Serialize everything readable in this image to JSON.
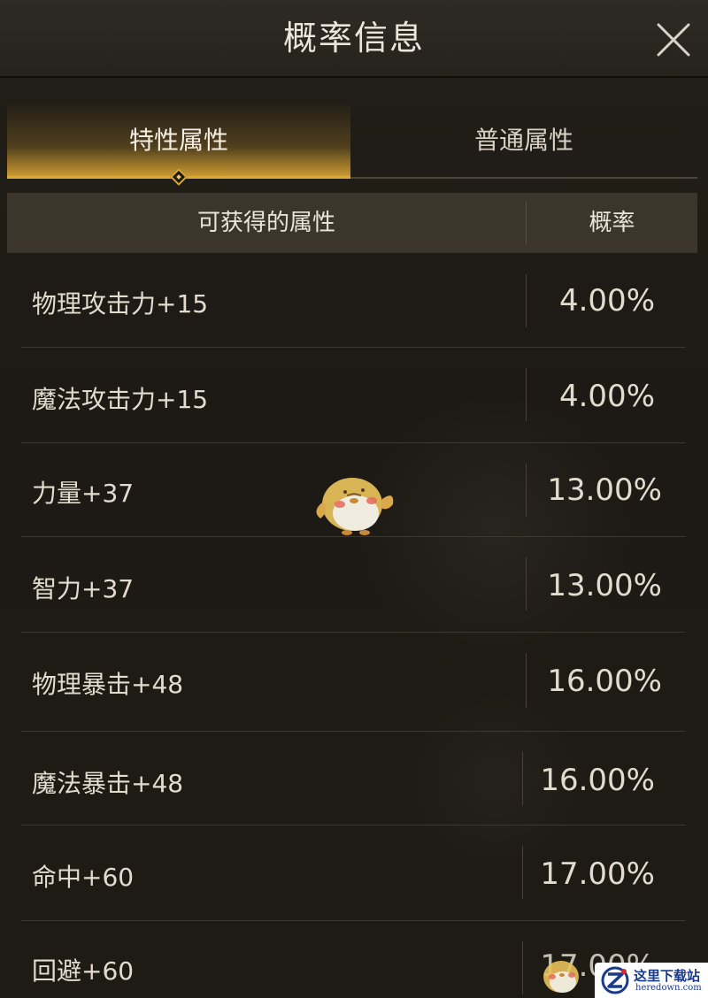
{
  "dialog": {
    "title": "概率信息"
  },
  "tabs": [
    {
      "label": "特性属性",
      "active": true
    },
    {
      "label": "普通属性",
      "active": false
    }
  ],
  "table": {
    "headers": {
      "attribute": "可获得的属性",
      "probability": "概率"
    },
    "rows": [
      {
        "attribute": "物理攻击力+15",
        "probability": "4.00%"
      },
      {
        "attribute": "魔法攻击力+15",
        "probability": "4.00%"
      },
      {
        "attribute": "力量+37",
        "probability": "13.00%"
      },
      {
        "attribute": "智力+37",
        "probability": "13.00%"
      },
      {
        "attribute": "物理暴击+48",
        "probability": "16.00%"
      },
      {
        "attribute": "魔法暴击+48",
        "probability": "16.00%"
      },
      {
        "attribute": "命中+60",
        "probability": "17.00%"
      },
      {
        "attribute": "回避+60",
        "probability": "17.00%"
      }
    ]
  },
  "watermark": {
    "site_name": "这里下载站",
    "site_url": "heredown.com"
  },
  "colors": {
    "accent_gold": "#d8a838",
    "background": "#1d1a15",
    "header_bg": "#3b352c"
  }
}
